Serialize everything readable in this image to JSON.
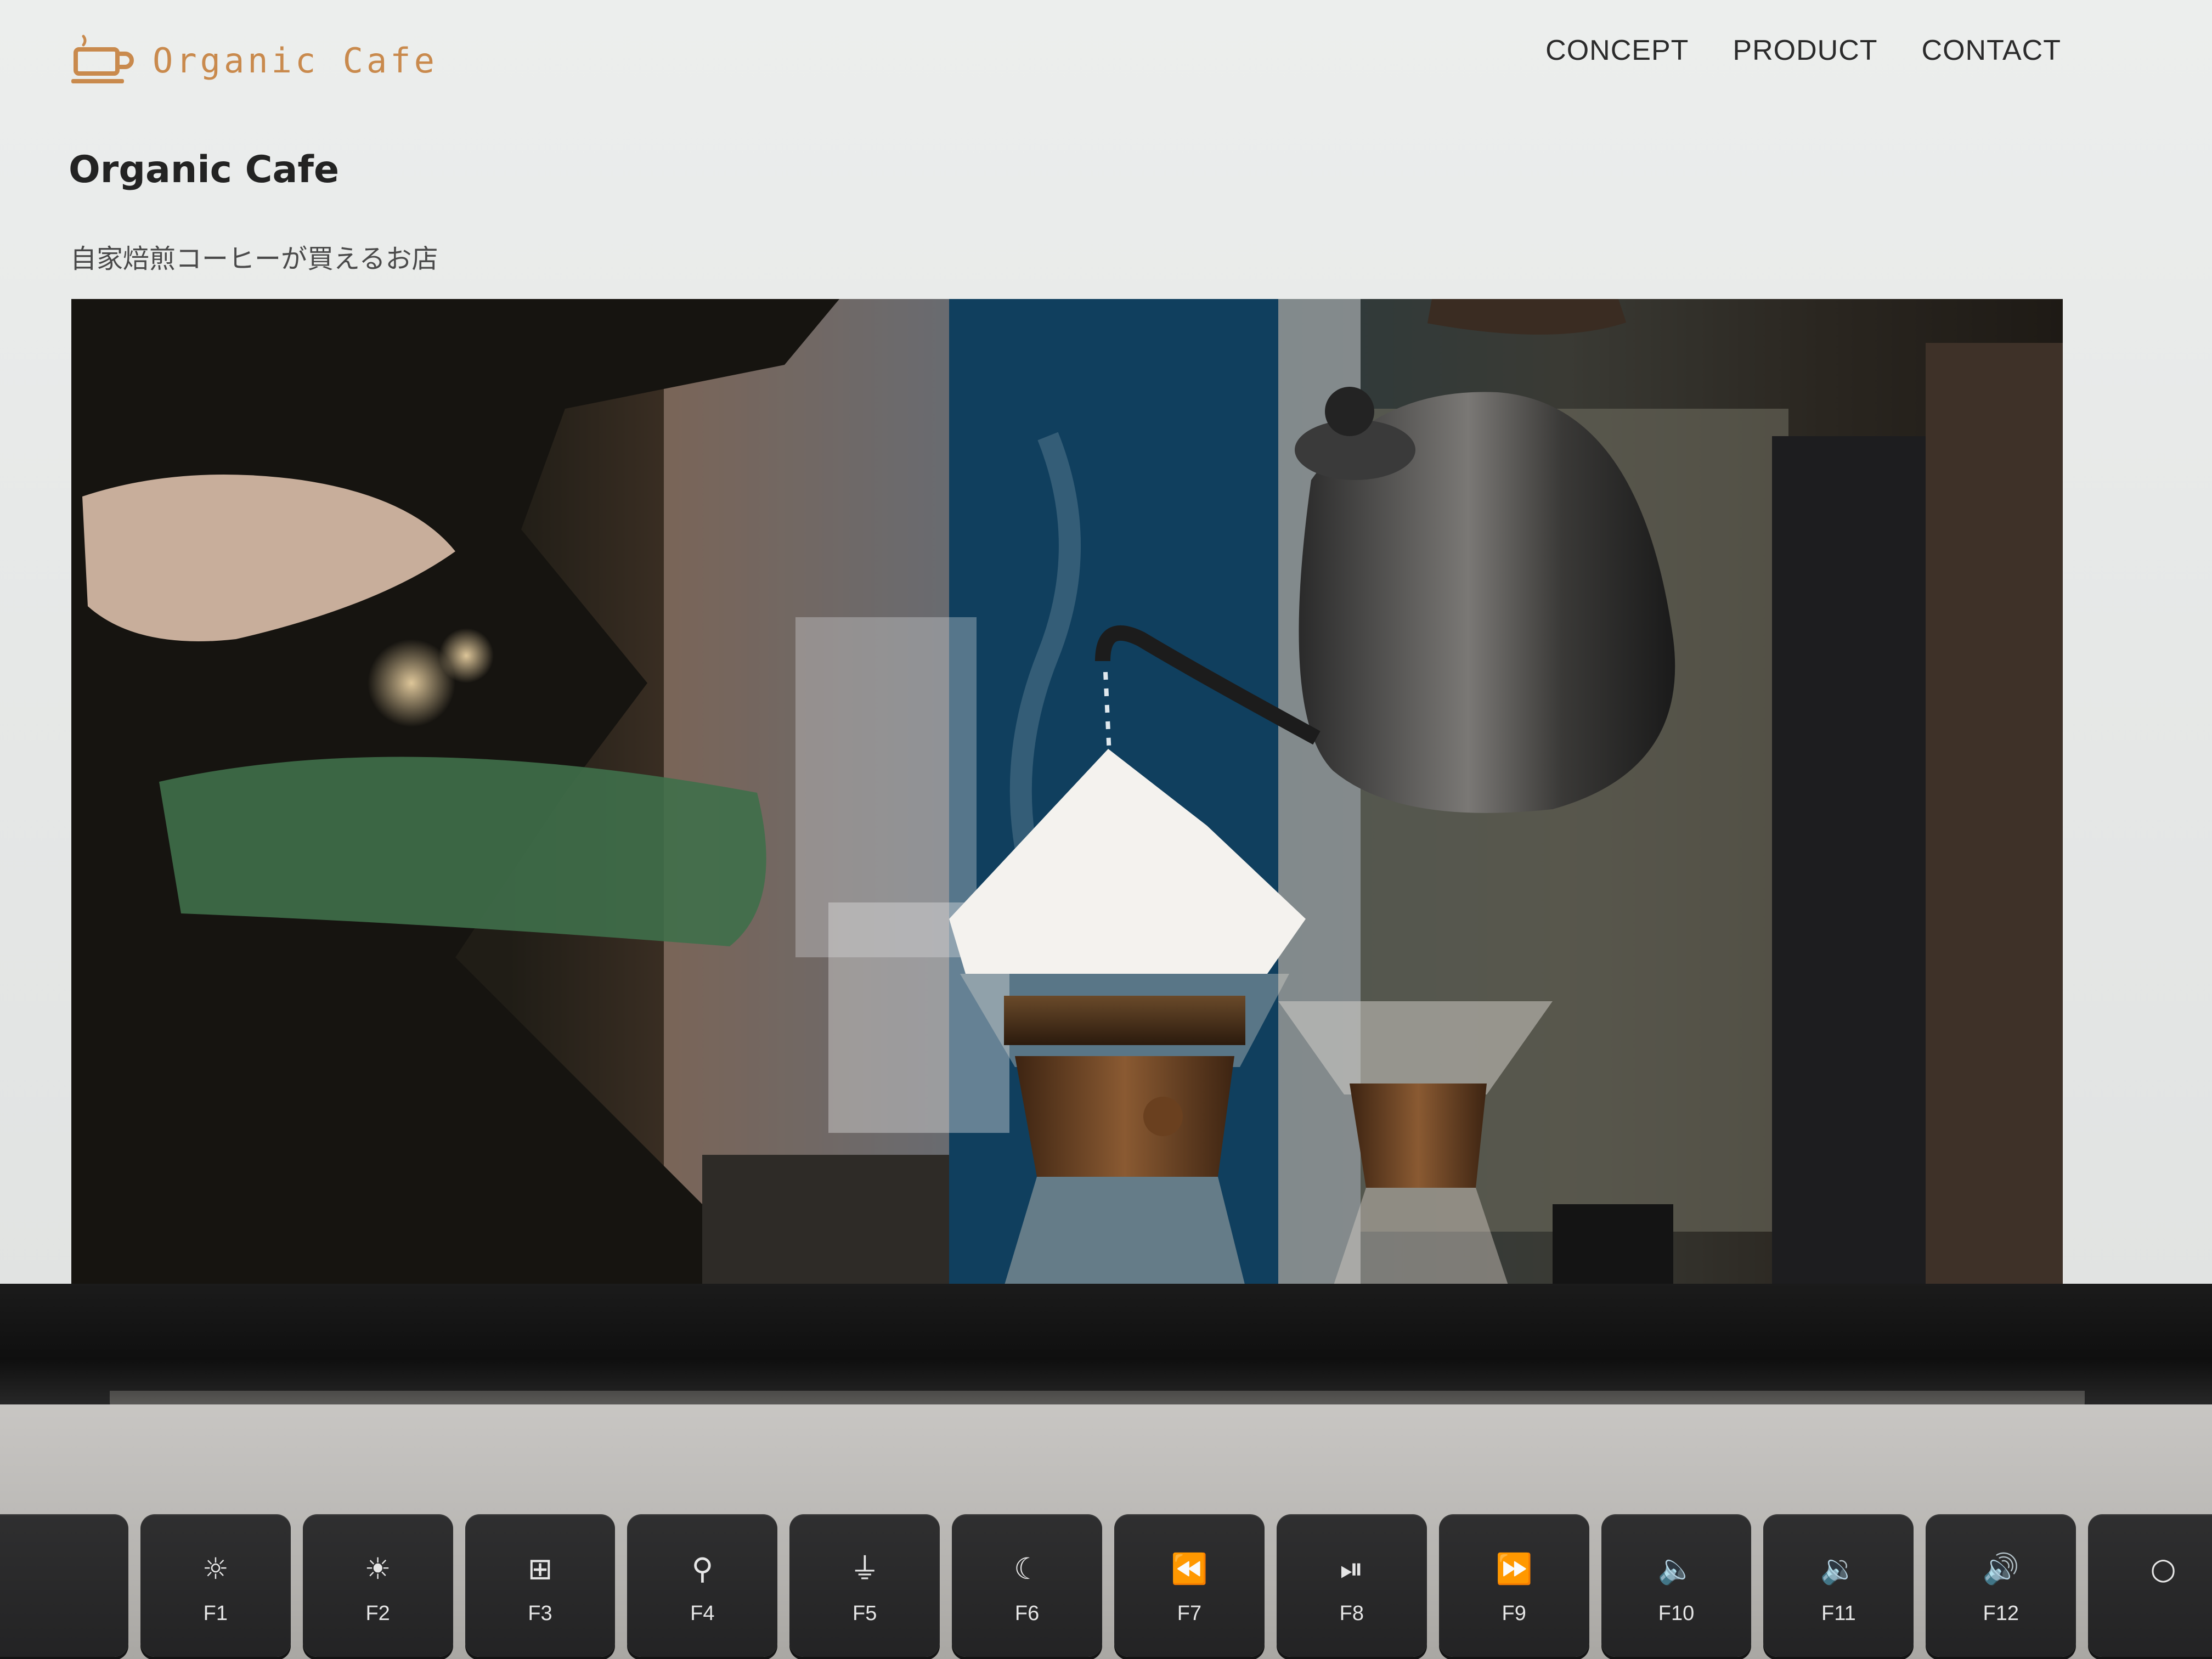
{
  "site": {
    "logo_text": "Organic Cafe",
    "nav": [
      "CONCEPT",
      "PRODUCT",
      "CONTACT"
    ],
    "title": "Organic Cafe",
    "subtitle": "自家焙煎コーヒーが買えるお店"
  },
  "keyboard": {
    "function_keys": [
      {
        "label": "",
        "icon": "blank-key"
      },
      {
        "label": "F1",
        "icon": "brightness-down-icon"
      },
      {
        "label": "F2",
        "icon": "brightness-up-icon"
      },
      {
        "label": "F3",
        "icon": "mission-control-icon"
      },
      {
        "label": "F4",
        "icon": "search-icon"
      },
      {
        "label": "F5",
        "icon": "microphone-icon"
      },
      {
        "label": "F6",
        "icon": "moon-icon"
      },
      {
        "label": "F7",
        "icon": "rewind-icon"
      },
      {
        "label": "F8",
        "icon": "play-pause-icon"
      },
      {
        "label": "F9",
        "icon": "fast-forward-icon"
      },
      {
        "label": "F10",
        "icon": "mute-icon"
      },
      {
        "label": "F11",
        "icon": "volume-down-icon"
      },
      {
        "label": "F12",
        "icon": "volume-up-icon"
      },
      {
        "label": "",
        "icon": "power-icon"
      }
    ]
  },
  "colors": {
    "logo_accent": "#c98a4d",
    "page_background": "#e8eae9",
    "nav_text": "#2b2b2b",
    "key_face": "#2a2a2b"
  }
}
